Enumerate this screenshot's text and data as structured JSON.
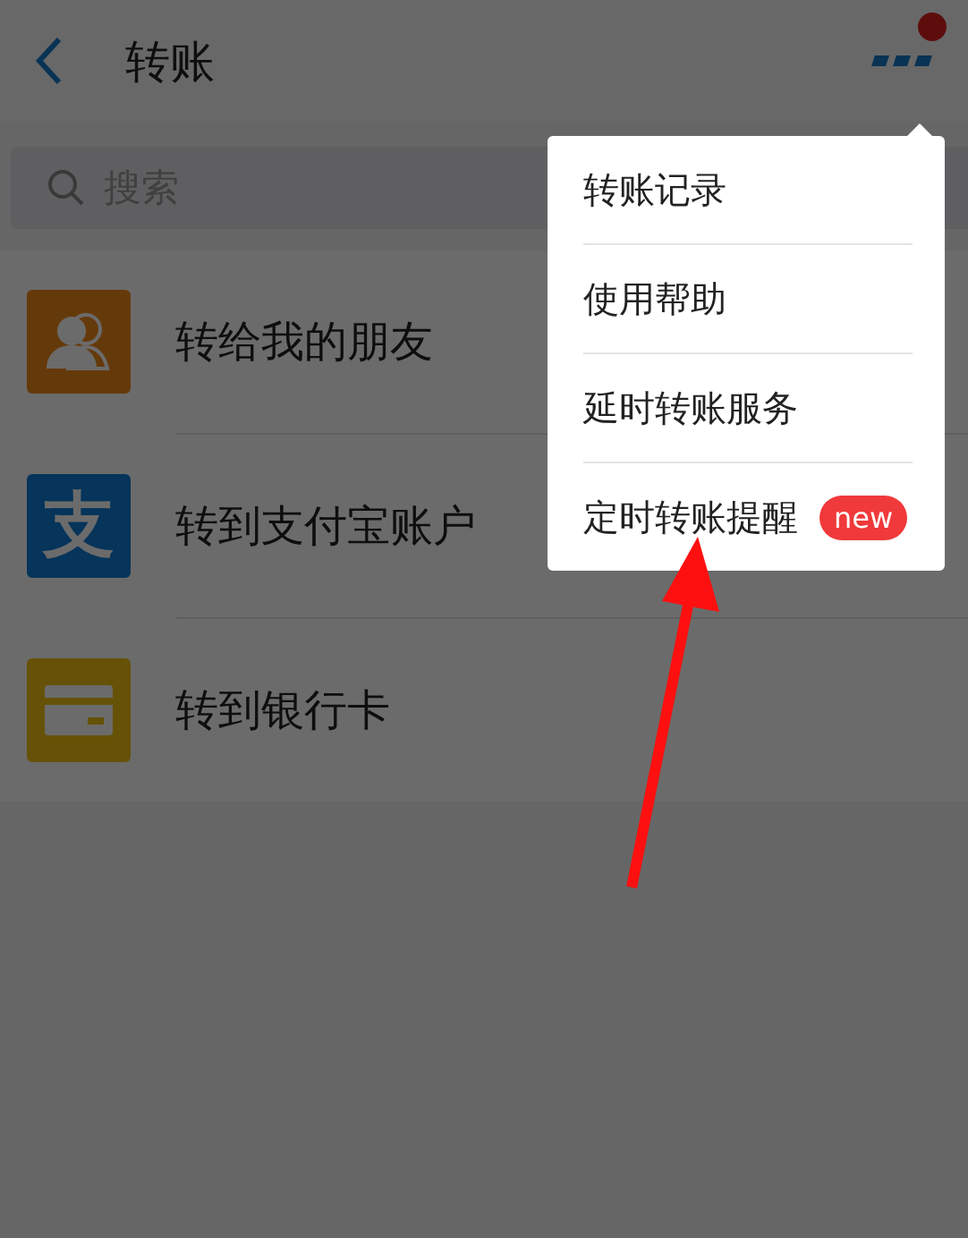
{
  "header": {
    "title": "转账",
    "has_notification": true
  },
  "search": {
    "placeholder": "搜索"
  },
  "rows": [
    {
      "kind": "friends",
      "label": "转给我的朋友"
    },
    {
      "kind": "alipay",
      "label": "转到支付宝账户",
      "icon_text": "支"
    },
    {
      "kind": "bank",
      "label": "转到银行卡"
    }
  ],
  "menu": {
    "open": true,
    "items": [
      {
        "label": "转账记录"
      },
      {
        "label": "使用帮助"
      },
      {
        "label": "延时转账服务"
      },
      {
        "label": "定时转账提醒",
        "badge": "new"
      }
    ]
  }
}
